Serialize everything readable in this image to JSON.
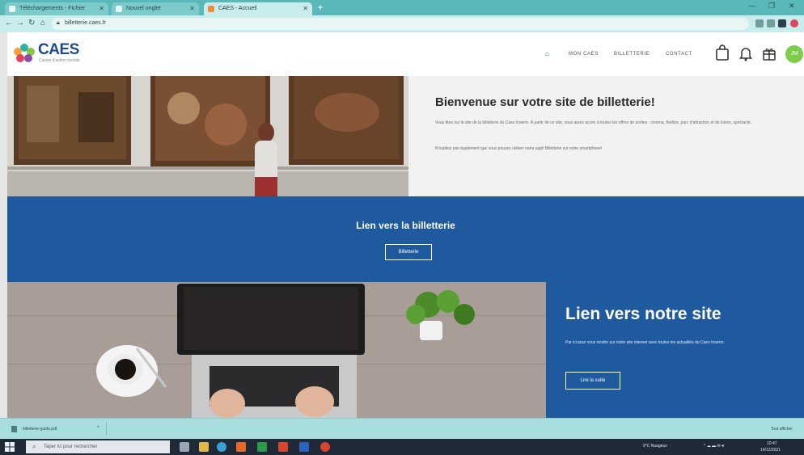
{
  "browser": {
    "tabs": [
      {
        "label": "Téléchargements - Fichier"
      },
      {
        "label": "Nouvel onglet"
      },
      {
        "label": "CAES - Accueil"
      }
    ],
    "new_tab_label": "+",
    "url": "billetterie.caes.fr"
  },
  "site": {
    "logo": {
      "name": "CAES",
      "subtitle": "Caisse d'action sociale"
    },
    "nav": [
      {
        "label": "⌂"
      },
      {
        "label": "MON CAES"
      },
      {
        "label": "BILLETTERIE"
      },
      {
        "label": "CONTACT"
      }
    ],
    "avatar_initials": "JM"
  },
  "hero": {
    "title": "Bienvenue sur votre site de billetterie!",
    "paragraph1": "Vous êtes sur le site de la billetterie du Caes Inserm. À partir de ce site, vous aurez accès à toutes les offres de sorties : cinéma, théâtre, parc d'attraction et de loisirs, spectacle.",
    "paragraph2": "N'oubliez pas également que vous pouvez utiliser notre appli Billetterie sur votre smartphone!"
  },
  "billetterie": {
    "title": "Lien vers la billetterie",
    "button": "Billetterie"
  },
  "site_link": {
    "title": "Lien vers notre site",
    "paragraph": "Par ici pour vous rendre sur notre site internet avec toutes les actualités du Caes Inserm.",
    "button": "Lire la suite"
  },
  "downloads": {
    "item": "billetterie-guide.pdf",
    "chevron": "^",
    "show_all": "Tout afficher"
  },
  "taskbar": {
    "search_placeholder": "Taper ici pour rechercher",
    "tray_weather": "9°C Nuageux",
    "tray_time": "10:47",
    "tray_date": "14/12/2021"
  },
  "colors": {
    "brand_blue": "#1f5a9e",
    "tab_strip": "#5ab8b8",
    "avatar_green": "#7dcc4a"
  }
}
